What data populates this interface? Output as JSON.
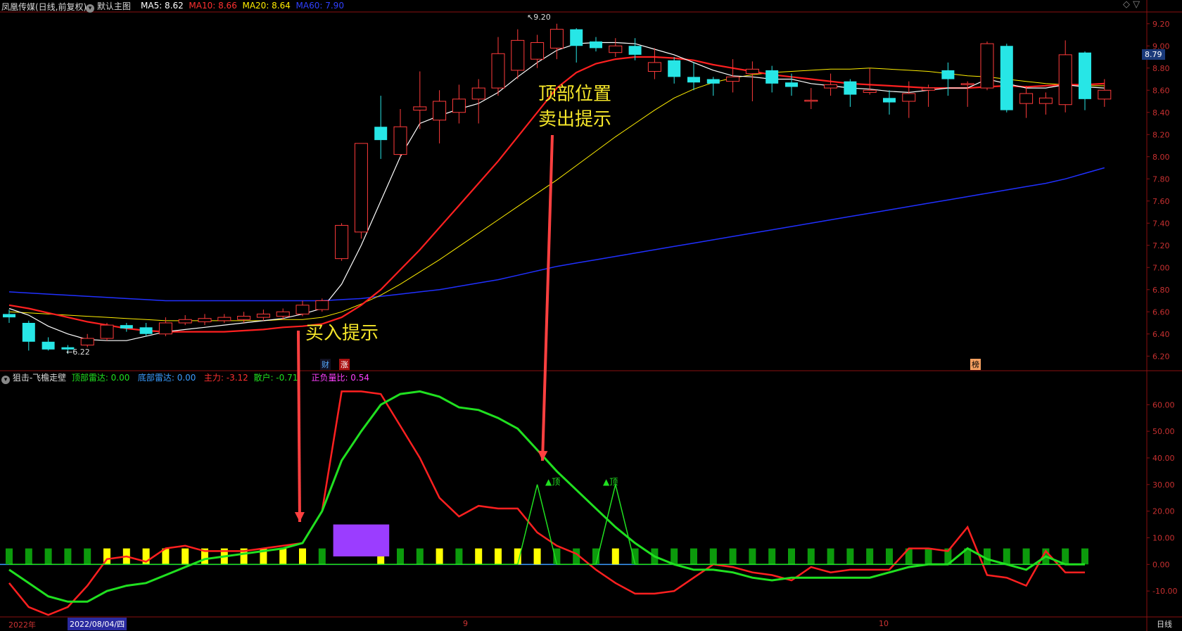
{
  "header": {
    "stock_name": "凤凰传媒(日线,前复权)",
    "main_label": "默认主图",
    "ma5": "MA5: 8.62",
    "ma10": "MA10: 8.66",
    "ma20": "MA20: 8.64",
    "ma60": "MA60: 7.90",
    "colors": {
      "ma5": "#ffffff",
      "ma10": "#ff3030",
      "ma20": "#ffee00",
      "ma60": "#2030ff"
    }
  },
  "indicator_header": {
    "name": "狙击-飞檐走壁",
    "top_radar": "顶部雷达: 0.00",
    "bottom_radar": "底部雷达: 0.00",
    "main_force": "主力: -3.12",
    "retail": "散户: -0.71",
    "ratio": "正负量比: 0.54"
  },
  "annotations": {
    "buy": "买入提示",
    "sell_line1": "顶部位置",
    "sell_line2": "卖出提示",
    "top_tag": "▲顶"
  },
  "markers": {
    "cai": "财",
    "zhang": "涨",
    "bang": "榜"
  },
  "bottom_axis": {
    "year": "2022年",
    "date_box": "2022/08/04/四",
    "month9": "9",
    "month10": "10",
    "period": "日线"
  },
  "price_labels": {
    "high": "9.20",
    "low": "6.22",
    "current": "8.79"
  },
  "chart_data": [
    {
      "type": "candlestick",
      "ylim": [
        6.1,
        9.3
      ],
      "y_ticks": [
        "6.20",
        "6.40",
        "6.60",
        "6.80",
        "7.00",
        "7.20",
        "7.40",
        "7.60",
        "7.80",
        "8.00",
        "8.20",
        "8.40",
        "8.60",
        "8.80",
        "9.00",
        "9.20"
      ],
      "candles": [
        {
          "o": 6.58,
          "c": 6.55,
          "h": 6.62,
          "l": 6.5
        },
        {
          "o": 6.5,
          "c": 6.33,
          "h": 6.52,
          "l": 6.25
        },
        {
          "o": 6.33,
          "c": 6.26,
          "h": 6.37,
          "l": 6.25
        },
        {
          "o": 6.28,
          "c": 6.26,
          "h": 6.3,
          "l": 6.22
        },
        {
          "o": 6.3,
          "c": 6.36,
          "h": 6.4,
          "l": 6.28
        },
        {
          "o": 6.36,
          "c": 6.48,
          "h": 6.5,
          "l": 6.34
        },
        {
          "o": 6.48,
          "c": 6.45,
          "h": 6.5,
          "l": 6.42
        },
        {
          "o": 6.46,
          "c": 6.4,
          "h": 6.5,
          "l": 6.38
        },
        {
          "o": 6.4,
          "c": 6.5,
          "h": 6.55,
          "l": 6.38
        },
        {
          "o": 6.5,
          "c": 6.53,
          "h": 6.57,
          "l": 6.48
        },
        {
          "o": 6.51,
          "c": 6.54,
          "h": 6.58,
          "l": 6.48
        },
        {
          "o": 6.52,
          "c": 6.55,
          "h": 6.58,
          "l": 6.5
        },
        {
          "o": 6.53,
          "c": 6.56,
          "h": 6.6,
          "l": 6.5
        },
        {
          "o": 6.55,
          "c": 6.58,
          "h": 6.62,
          "l": 6.52
        },
        {
          "o": 6.56,
          "c": 6.6,
          "h": 6.63,
          "l": 6.53
        },
        {
          "o": 6.58,
          "c": 6.66,
          "h": 6.7,
          "l": 6.56
        },
        {
          "o": 6.62,
          "c": 6.7,
          "h": 6.72,
          "l": 6.6
        },
        {
          "o": 7.08,
          "c": 7.38,
          "h": 7.4,
          "l": 7.06
        },
        {
          "o": 7.32,
          "c": 8.12,
          "h": 8.12,
          "l": 7.26
        },
        {
          "o": 8.27,
          "c": 8.15,
          "h": 8.55,
          "l": 7.98
        },
        {
          "o": 8.02,
          "c": 8.27,
          "h": 8.43,
          "l": 8.0
        },
        {
          "o": 8.42,
          "c": 8.45,
          "h": 8.77,
          "l": 8.25
        },
        {
          "o": 8.33,
          "c": 8.5,
          "h": 8.6,
          "l": 8.12
        },
        {
          "o": 8.4,
          "c": 8.52,
          "h": 8.65,
          "l": 8.3
        },
        {
          "o": 8.52,
          "c": 8.62,
          "h": 8.7,
          "l": 8.3
        },
        {
          "o": 8.62,
          "c": 8.93,
          "h": 9.08,
          "l": 8.55
        },
        {
          "o": 8.78,
          "c": 9.05,
          "h": 9.15,
          "l": 8.7
        },
        {
          "o": 8.88,
          "c": 9.03,
          "h": 9.1,
          "l": 8.8
        },
        {
          "o": 8.98,
          "c": 9.15,
          "h": 9.2,
          "l": 8.88
        },
        {
          "o": 9.15,
          "c": 9.0,
          "h": 9.16,
          "l": 8.85
        },
        {
          "o": 9.04,
          "c": 8.98,
          "h": 9.08,
          "l": 8.95
        },
        {
          "o": 8.94,
          "c": 9.0,
          "h": 9.07,
          "l": 8.9
        },
        {
          "o": 9.0,
          "c": 8.92,
          "h": 9.07,
          "l": 8.87
        },
        {
          "o": 8.77,
          "c": 8.85,
          "h": 8.98,
          "l": 8.7
        },
        {
          "o": 8.87,
          "c": 8.72,
          "h": 8.9,
          "l": 8.66
        },
        {
          "o": 8.72,
          "c": 8.67,
          "h": 8.85,
          "l": 8.6
        },
        {
          "o": 8.7,
          "c": 8.66,
          "h": 8.72,
          "l": 8.55
        },
        {
          "o": 8.68,
          "c": 8.72,
          "h": 8.88,
          "l": 8.58
        },
        {
          "o": 8.75,
          "c": 8.79,
          "h": 8.86,
          "l": 8.5
        },
        {
          "o": 8.78,
          "c": 8.66,
          "h": 8.82,
          "l": 8.58
        },
        {
          "o": 8.67,
          "c": 8.63,
          "h": 8.75,
          "l": 8.55
        },
        {
          "o": 8.5,
          "c": 8.51,
          "h": 8.62,
          "l": 8.43
        },
        {
          "o": 8.62,
          "c": 8.65,
          "h": 8.75,
          "l": 8.55
        },
        {
          "o": 8.68,
          "c": 8.56,
          "h": 8.7,
          "l": 8.45
        },
        {
          "o": 8.58,
          "c": 8.6,
          "h": 8.8,
          "l": 8.56
        },
        {
          "o": 8.53,
          "c": 8.49,
          "h": 8.6,
          "l": 8.38
        },
        {
          "o": 8.5,
          "c": 8.57,
          "h": 8.68,
          "l": 8.35
        },
        {
          "o": 8.6,
          "c": 8.62,
          "h": 8.65,
          "l": 8.45
        },
        {
          "o": 8.78,
          "c": 8.7,
          "h": 8.85,
          "l": 8.55
        },
        {
          "o": 8.65,
          "c": 8.66,
          "h": 8.68,
          "l": 8.45
        },
        {
          "o": 8.62,
          "c": 9.02,
          "h": 9.04,
          "l": 8.6
        },
        {
          "o": 9.0,
          "c": 8.42,
          "h": 9.02,
          "l": 8.4
        },
        {
          "o": 8.48,
          "c": 8.57,
          "h": 8.64,
          "l": 8.35
        },
        {
          "o": 8.48,
          "c": 8.53,
          "h": 8.58,
          "l": 8.38
        },
        {
          "o": 8.47,
          "c": 8.92,
          "h": 9.05,
          "l": 8.4
        },
        {
          "o": 8.94,
          "c": 8.52,
          "h": 8.95,
          "l": 8.42
        },
        {
          "o": 8.52,
          "c": 8.6,
          "h": 8.7,
          "l": 8.45
        }
      ],
      "ma5": [
        6.63,
        6.57,
        6.47,
        6.4,
        6.35,
        6.34,
        6.34,
        6.38,
        6.42,
        6.44,
        6.46,
        6.48,
        6.5,
        6.52,
        6.54,
        6.58,
        6.63,
        6.85,
        7.2,
        7.6,
        8.0,
        8.3,
        8.37,
        8.43,
        8.48,
        8.58,
        8.72,
        8.85,
        8.96,
        9.02,
        9.03,
        9.03,
        9.02,
        8.97,
        8.92,
        8.85,
        8.78,
        8.73,
        8.72,
        8.7,
        8.7,
        8.66,
        8.64,
        8.62,
        8.61,
        8.59,
        8.58,
        8.6,
        8.62,
        8.62,
        8.7,
        8.66,
        8.62,
        8.62,
        8.65,
        8.63,
        8.62
      ],
      "ma10": [
        6.66,
        6.63,
        6.59,
        6.55,
        6.51,
        6.48,
        6.45,
        6.43,
        6.42,
        6.42,
        6.42,
        6.42,
        6.43,
        6.44,
        6.46,
        6.47,
        6.49,
        6.55,
        6.66,
        6.8,
        6.98,
        7.16,
        7.36,
        7.56,
        7.76,
        7.96,
        8.18,
        8.4,
        8.62,
        8.76,
        8.84,
        8.88,
        8.9,
        8.9,
        8.89,
        8.87,
        8.83,
        8.8,
        8.77,
        8.74,
        8.72,
        8.7,
        8.68,
        8.66,
        8.65,
        8.64,
        8.63,
        8.62,
        8.62,
        8.62,
        8.63,
        8.64,
        8.63,
        8.64,
        8.65,
        8.65,
        8.66
      ],
      "ma20": [
        6.6,
        6.59,
        6.58,
        6.57,
        6.56,
        6.55,
        6.54,
        6.53,
        6.52,
        6.52,
        6.52,
        6.52,
        6.52,
        6.52,
        6.53,
        6.53,
        6.55,
        6.6,
        6.67,
        6.75,
        6.85,
        6.96,
        7.07,
        7.19,
        7.31,
        7.43,
        7.55,
        7.67,
        7.79,
        7.92,
        8.05,
        8.18,
        8.3,
        8.42,
        8.53,
        8.61,
        8.67,
        8.71,
        8.74,
        8.76,
        8.77,
        8.78,
        8.79,
        8.79,
        8.8,
        8.79,
        8.78,
        8.77,
        8.75,
        8.73,
        8.72,
        8.7,
        8.68,
        8.66,
        8.65,
        8.64,
        8.64
      ],
      "ma60": [
        6.78,
        6.77,
        6.76,
        6.75,
        6.74,
        6.73,
        6.72,
        6.71,
        6.7,
        6.7,
        6.7,
        6.7,
        6.7,
        6.7,
        6.7,
        6.7,
        6.7,
        6.71,
        6.72,
        6.74,
        6.76,
        6.78,
        6.8,
        6.83,
        6.86,
        6.89,
        6.93,
        6.97,
        7.01,
        7.04,
        7.07,
        7.1,
        7.13,
        7.16,
        7.19,
        7.22,
        7.25,
        7.28,
        7.31,
        7.34,
        7.37,
        7.4,
        7.43,
        7.46,
        7.49,
        7.52,
        7.55,
        7.58,
        7.61,
        7.64,
        7.67,
        7.7,
        7.73,
        7.76,
        7.8,
        7.85,
        7.9
      ]
    },
    {
      "type": "line",
      "ylim": [
        -20,
        68
      ],
      "y_ticks": [
        "-10.00",
        "0.00",
        "10.00",
        "20.00",
        "30.00",
        "40.00",
        "50.00",
        "60.00"
      ],
      "series": [
        {
          "name": "主力",
          "color": "#ff2020",
          "values": [
            -7,
            -16,
            -19,
            -16,
            -8,
            2,
            3,
            1,
            6,
            7,
            5,
            5,
            5,
            6,
            7,
            8,
            20,
            65,
            65,
            64,
            52,
            40,
            25,
            18,
            22,
            21,
            21,
            12,
            7,
            4,
            -2,
            -7,
            -11,
            -11,
            -10,
            -5,
            0,
            -1,
            -3,
            -4,
            -6,
            -1,
            -3,
            -2,
            -2,
            -2,
            6,
            6,
            5,
            14,
            -4,
            -5,
            -8,
            5,
            -3,
            -3
          ]
        },
        {
          "name": "散户",
          "color": "#20e020",
          "values": [
            -2,
            -7,
            -12,
            -14,
            -14,
            -10,
            -8,
            -7,
            -4,
            -1,
            2,
            3,
            4,
            5,
            6,
            8,
            20,
            39,
            50,
            60,
            64,
            65,
            63,
            59,
            58,
            55,
            51,
            43,
            35,
            28,
            21,
            14,
            8,
            3,
            0,
            -2,
            -2,
            -3,
            -5,
            -6,
            -5,
            -5,
            -5,
            -5,
            -5,
            -3,
            -1,
            0,
            0,
            6,
            2,
            0,
            -2,
            3,
            0,
            0
          ]
        },
        {
          "name": "顶部雷达",
          "color": "#20e020",
          "values": [
            0,
            0,
            0,
            0,
            0,
            0,
            0,
            0,
            0,
            0,
            0,
            0,
            0,
            0,
            0,
            0,
            0,
            0,
            0,
            0,
            0,
            0,
            0,
            0,
            0,
            0,
            0,
            30,
            0,
            0,
            0,
            30,
            0,
            0,
            0,
            0,
            0,
            0,
            0,
            0,
            0,
            0,
            0,
            0,
            0,
            0,
            0,
            0,
            0,
            0,
            0,
            0,
            0,
            0,
            0,
            0
          ]
        }
      ],
      "bars": [
        "G",
        "G",
        "G",
        "G",
        "G",
        "Y",
        "Y",
        "Y",
        "Y",
        "Y",
        "Y",
        "Y",
        "Y",
        "Y",
        "Y",
        "Y",
        "G",
        "P",
        "P",
        "Y",
        "G",
        "G",
        "Y",
        "G",
        "Y",
        "Y",
        "Y",
        "Y",
        "G",
        "G",
        "G",
        "Y",
        "G",
        "G",
        "G",
        "G",
        "G",
        "G",
        "G",
        "G",
        "G",
        "G",
        "G",
        "G",
        "G",
        "G",
        "G",
        "G",
        "G",
        "G",
        "G",
        "G",
        "G",
        "G",
        "G",
        "G"
      ]
    }
  ]
}
